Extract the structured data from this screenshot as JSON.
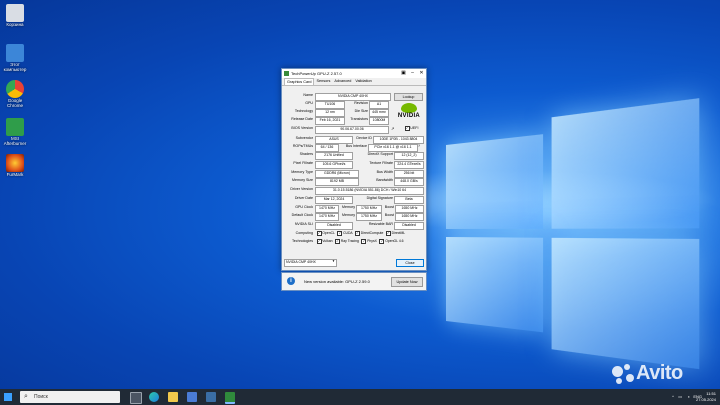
{
  "desktop": {
    "icons": [
      {
        "label": "Корзина",
        "color": "#d9dde4"
      },
      {
        "label": "Этот компьютер",
        "color": "#3c86d8"
      },
      {
        "label": "Google Chrome",
        "color": "#e94235"
      },
      {
        "label": "MSI Afterburner",
        "color": "#2f9d4a"
      },
      {
        "label": "FurMark",
        "color": "#e0521b"
      }
    ]
  },
  "gpuz": {
    "title": "TechPowerUp GPU-Z 2.57.0",
    "tabs": [
      "Graphics Card",
      "Sensors",
      "Advanced",
      "Validation"
    ],
    "name_label": "Name",
    "name_value": "NVIDIA CMP 40HX",
    "lookup_label": "Lookup",
    "gpu_label": "GPU",
    "gpu_value": "TU106",
    "revision_label": "Revision",
    "revision_value": "A1",
    "technology_label": "Technology",
    "technology_value": "12 nm",
    "diesize_label": "Die Size",
    "diesize_value": "445 mm²",
    "release_label": "Release Date",
    "release_value": "Feb 16, 2021",
    "transistors_label": "Transistors",
    "transistors_value": "10800M",
    "bios_label": "BIOS Version",
    "bios_value": "90.06.67.00.06",
    "uefi_label": "UEFI",
    "subvendor_label": "Subvendor",
    "subvendor_value": "ASUS",
    "deviceid_label": "Device ID",
    "deviceid_value": "10DE 1F0B - 1043 8804",
    "rops_label": "ROPs/TMUs",
    "rops_value": "64 / 136",
    "bus_label": "Bus Interface",
    "bus_value": "PCIe x16 1.1 @ x16 1.1",
    "bus_help": "?",
    "shaders_label": "Shaders",
    "shaders_value": "2176 Unified",
    "dx_label": "DirectX Support",
    "dx_value": "12 (12_2)",
    "pixel_label": "Pixel Fillrate",
    "pixel_value": "105.6 GPixel/s",
    "texture_label": "Texture Fillrate",
    "texture_value": "224.4 GTexel/s",
    "memtype_label": "Memory Type",
    "memtype_value": "GDDR6 (Micron)",
    "buswidth_label": "Bus Width",
    "buswidth_value": "256 bit",
    "memsize_label": "Memory Size",
    "memsize_value": "8192 MB",
    "bandwidth_label": "Bandwidth",
    "bandwidth_value": "448.0 GB/s",
    "driver_label": "Driver Version",
    "driver_value": "31.0.15.5186 (NVIDIA 551.86) DCH / Win10 64",
    "driverdate_label": "Driver Date",
    "driverdate_value": "Mar 12, 2024",
    "digsig_label": "Digital Signature",
    "digsig_value": "Beta",
    "gpuclock_label": "GPU Clock",
    "gpuclock_value": "1470 MHz",
    "memory_label": "Memory",
    "memory_value": "1750 MHz",
    "boost_label": "Boost",
    "boost_value": "1650 MHz",
    "defclock_label": "Default Clock",
    "defclock_value": "1470 MHz",
    "defmemory_value": "1750 MHz",
    "defboost_value": "1650 MHz",
    "sli_label": "NVIDIA SLI",
    "sli_value": "Disabled",
    "rbar_label": "Resizable BAR",
    "rbar_value": "Disabled",
    "computing_label": "Computing",
    "computing_items": [
      "OpenCL",
      "CUDA",
      "DirectCompute",
      "DirectML"
    ],
    "tech_label": "Technologies",
    "tech_items": [
      "Vulkan",
      "Ray Tracing",
      "PhysX",
      "OpenGL 4.6"
    ],
    "selected_gpu": "NVIDIA CMP 40HX",
    "close_label": "Close",
    "vendor_logo": "NVIDIA"
  },
  "notification": {
    "text": "New version available: GPU-Z 2.59.0",
    "button": "Update Now"
  },
  "taskbar": {
    "search_placeholder": "Поиск",
    "lang": "ENG",
    "time": "11:51",
    "date": "27.05.2024"
  },
  "watermark": "Avito"
}
